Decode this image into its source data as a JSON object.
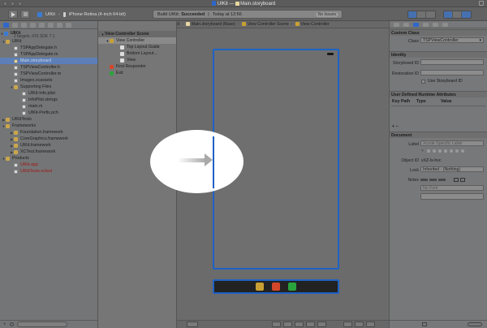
{
  "window": {
    "title_prefix": "UIKit",
    "title_sep": "—",
    "title_file": "Main.storyboard"
  },
  "toolbar": {
    "scheme_app": "UIKit",
    "scheme_sep": "›",
    "scheme_device": "iPhone Retina (4-inch 64-bit)",
    "activity_prefix": "Build UIKit:",
    "activity_status": "Succeeded",
    "activity_sep": "|",
    "activity_time": "Today at 12:56",
    "issues": "No Issues"
  },
  "navigator": {
    "project_name": "UIKit",
    "project_sub": "2 targets, iOS SDK 7.1",
    "rows": [
      {
        "label": "UIKit",
        "tri": "▼",
        "icon": "folder-icon"
      },
      {
        "label": "TSPAppDelegate.h",
        "tri": "",
        "icon": "file-icon"
      },
      {
        "label": "TSPAppDelegate.m",
        "tri": "",
        "icon": "file-icon"
      },
      {
        "label": "Main.storyboard",
        "tri": "",
        "icon": "storyboard-icon"
      },
      {
        "label": "TSPViewController.h",
        "tri": "",
        "icon": "file-icon"
      },
      {
        "label": "TSPViewController.m",
        "tri": "",
        "icon": "file-icon"
      },
      {
        "label": "Images.xcassets",
        "tri": "",
        "icon": "file-icon"
      },
      {
        "label": "Supporting Files",
        "tri": "▼",
        "icon": "folder-icon"
      },
      {
        "label": "UIKit-Info.plist",
        "tri": "",
        "icon": "file-icon"
      },
      {
        "label": "InfoPlist.strings",
        "tri": "",
        "icon": "file-icon"
      },
      {
        "label": "main.m",
        "tri": "",
        "icon": "file-icon"
      },
      {
        "label": "UIKit-Prefix.pch",
        "tri": "",
        "icon": "file-icon"
      },
      {
        "label": "UIKitTests",
        "tri": "▶",
        "icon": "folder-icon"
      },
      {
        "label": "Frameworks",
        "tri": "▼",
        "icon": "folder-icon"
      },
      {
        "label": "Foundation.framework",
        "tri": "▶",
        "icon": "framework-icon"
      },
      {
        "label": "CoreGraphics.framework",
        "tri": "▶",
        "icon": "framework-icon"
      },
      {
        "label": "UIKit.framework",
        "tri": "▶",
        "icon": "framework-icon"
      },
      {
        "label": "XCTest.framework",
        "tri": "▶",
        "icon": "framework-icon"
      },
      {
        "label": "Products",
        "tri": "▼",
        "icon": "folder-icon"
      },
      {
        "label": "UIKit.app",
        "tri": "",
        "icon": "file-icon"
      },
      {
        "label": "UIKitTests.xctest",
        "tri": "",
        "icon": "file-icon"
      }
    ]
  },
  "jumpbar": {
    "items": [
      "UIKit",
      "UIKit",
      "Main.storyboard",
      "Main.storyboard (Base)",
      "View Controller Scene",
      "View Controller"
    ]
  },
  "outline": {
    "rows": [
      {
        "label": "View Controller Scene",
        "tri": "▼"
      },
      {
        "label": "View Controller",
        "tri": "▼"
      },
      {
        "label": "Top Layout Guide",
        "tri": ""
      },
      {
        "label": "Bottom Layout...",
        "tri": ""
      },
      {
        "label": "View",
        "tri": ""
      },
      {
        "label": "First Responder",
        "tri": ""
      },
      {
        "label": "Exit",
        "tri": ""
      }
    ]
  },
  "inspector": {
    "custom_class_header": "Custom Class",
    "class_label": "Class",
    "class_value": "TSPViewController",
    "identity_header": "Identity",
    "storyboard_id_label": "Storyboard ID",
    "restoration_id_label": "Restoration ID",
    "use_storyboard_id": "Use Storyboard ID",
    "runtime_attrs_header": "User Defined Runtime Attributes",
    "col_key_path": "Key Path",
    "col_type": "Type",
    "col_value": "Value",
    "add_remove": "+  −",
    "document_header": "Document",
    "label_label": "Label",
    "label_placeholder": "Xcode Specific Label",
    "object_id_label": "Object ID",
    "object_id_value": "vXZ-lx-hvc",
    "lock_label": "Lock",
    "lock_value": "Inherited - (Nothing)",
    "notes_label": "Notes",
    "notes_font_placeholder": "No Font"
  }
}
